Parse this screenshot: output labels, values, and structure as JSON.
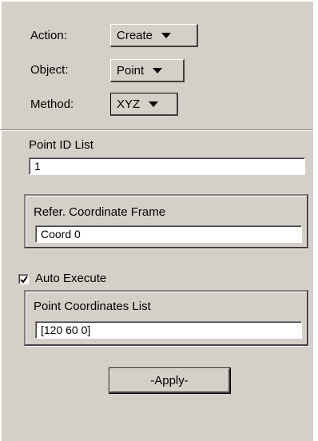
{
  "form": {
    "action_label": "Action:",
    "action_value": "Create",
    "object_label": "Object:",
    "object_value": "Point",
    "method_label": "Method:",
    "method_value": "XYZ"
  },
  "point_id": {
    "label": "Point ID List",
    "value": "1"
  },
  "ref_frame": {
    "label": "Refer. Coordinate Frame",
    "value": "Coord 0"
  },
  "auto_execute": {
    "label": "Auto Execute",
    "checked": true
  },
  "point_coords": {
    "label": "Point Coordinates List",
    "value": "[120 60 0]"
  },
  "apply_label": "-Apply-"
}
